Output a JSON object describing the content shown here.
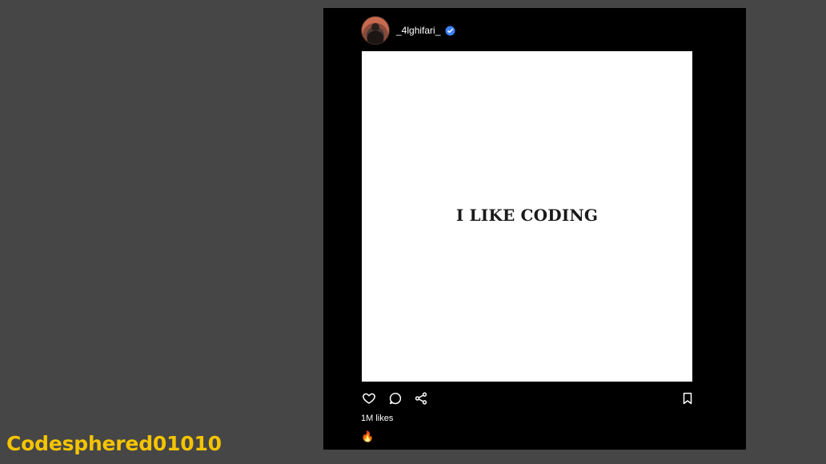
{
  "post": {
    "username": "_4lghifari_",
    "image_text": "I LIKE CODING",
    "likes_text": "1M likes",
    "caption_emoji": "🔥"
  },
  "icons": {
    "avatar": "avatar",
    "verified": "verified-badge-icon",
    "like": "heart-icon",
    "comment": "comment-icon",
    "share": "share-icon",
    "save": "bookmark-icon"
  },
  "watermark": {
    "text": "Codesphered01010"
  },
  "colors": {
    "background": "#464646",
    "card": "#000000",
    "image_bg": "#ffffff",
    "verified": "#3b82f6",
    "watermark": "#f5c400"
  }
}
